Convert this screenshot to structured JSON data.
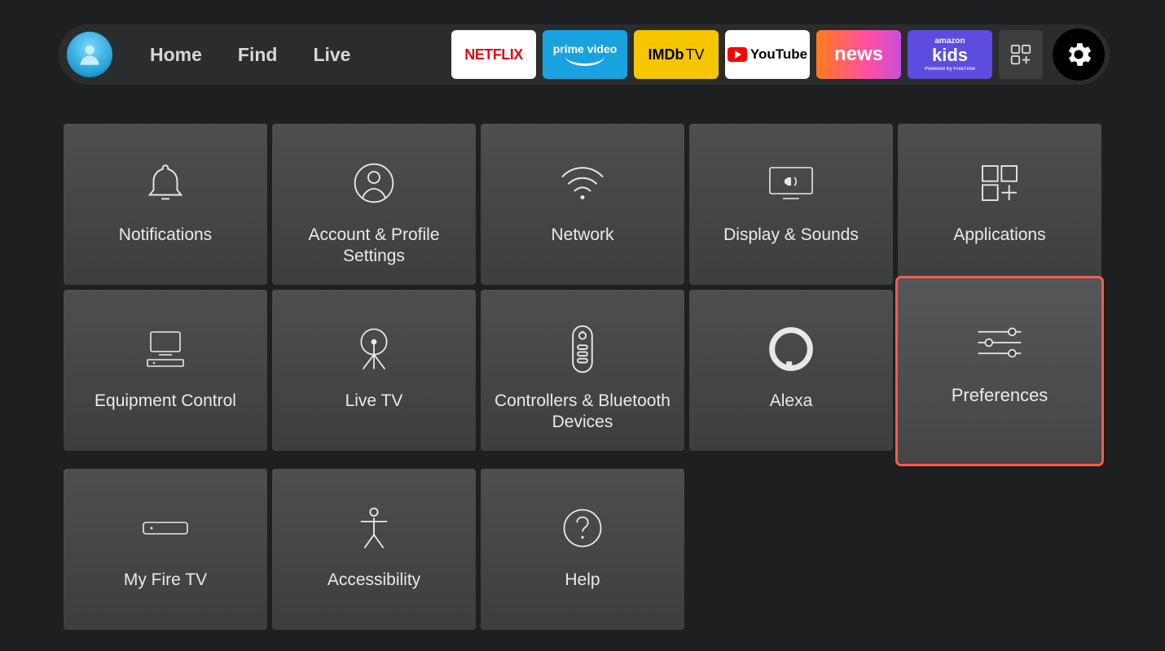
{
  "nav": {
    "links": [
      "Home",
      "Find",
      "Live"
    ],
    "apps": {
      "netflix": "NETFLIX",
      "primevideo_top": "prime video",
      "imdbtv_bold": "IMDb",
      "imdbtv_light": "TV",
      "youtube": "YouTube",
      "news": "news",
      "kids_brand": "amazon",
      "kids_word": "kids",
      "kids_sub": "Powered by FreeTime"
    }
  },
  "tiles": [
    {
      "id": "notifications",
      "label": "Notifications"
    },
    {
      "id": "account",
      "label": "Account & Profile Settings"
    },
    {
      "id": "network",
      "label": "Network"
    },
    {
      "id": "display",
      "label": "Display & Sounds"
    },
    {
      "id": "applications",
      "label": "Applications"
    },
    {
      "id": "equipment",
      "label": "Equipment Control"
    },
    {
      "id": "livetv",
      "label": "Live TV"
    },
    {
      "id": "controllers",
      "label": "Controllers & Bluetooth Devices"
    },
    {
      "id": "alexa",
      "label": "Alexa"
    },
    {
      "id": "preferences",
      "label": "Preferences",
      "highlighted": true
    },
    {
      "id": "myfiretv",
      "label": "My Fire TV"
    },
    {
      "id": "accessibility",
      "label": "Accessibility"
    },
    {
      "id": "help",
      "label": "Help"
    }
  ]
}
